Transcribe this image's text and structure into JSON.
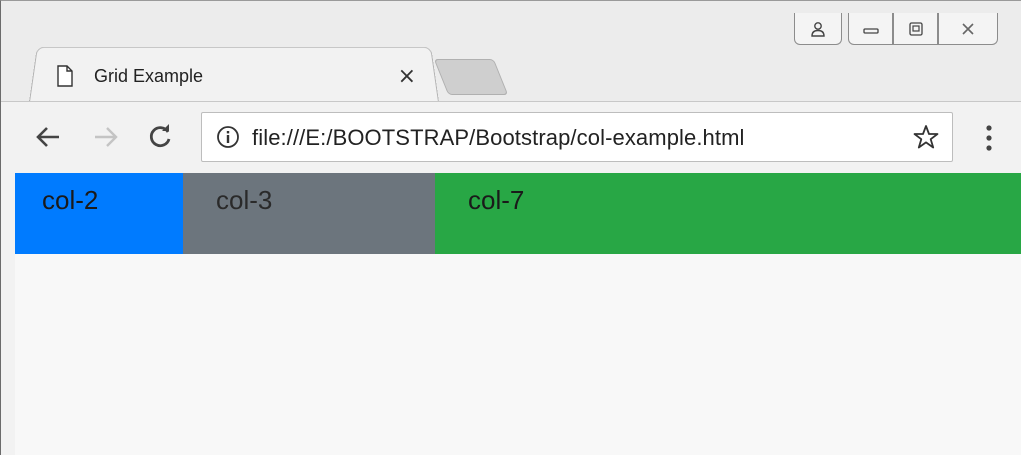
{
  "window": {
    "controls": {
      "profile_icon": "person-icon",
      "minimize_icon": "minimize-icon",
      "maximize_icon": "restore-icon",
      "close_icon": "close-icon"
    }
  },
  "tab": {
    "title": "Grid Example",
    "close_glyph": "×",
    "icon": "page-icon"
  },
  "toolbar": {
    "back_icon": "back-arrow-icon",
    "forward_icon": "forward-arrow-icon",
    "reload_icon": "reload-icon",
    "url": "file:///E:/BOOTSTRAP/Bootstrap/col-example.html",
    "info_icon": "info-icon",
    "bookmark_icon": "star-icon",
    "menu_icon": "more-vertical-icon"
  },
  "grid": {
    "columns": [
      {
        "label": "col-2",
        "color": "#007bff"
      },
      {
        "label": "col-3",
        "color": "#6c757d"
      },
      {
        "label": "col-7",
        "color": "#28a745"
      }
    ]
  }
}
